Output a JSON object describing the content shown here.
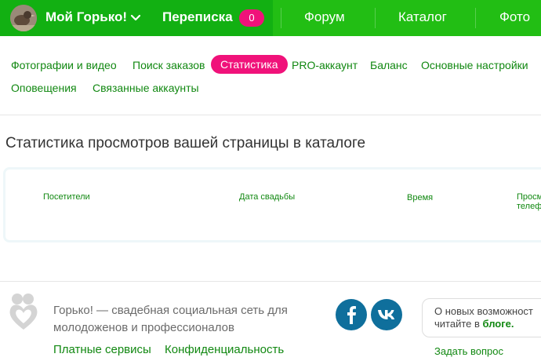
{
  "header": {
    "brand": "Мой Горько!",
    "messages_label": "Переписка",
    "messages_count": "0",
    "nav": [
      "Форум",
      "Каталог",
      "Фото"
    ]
  },
  "tabs": [
    "Фотографии и видео",
    "Поиск заказов",
    "Статистика",
    "PRO-аккаунт",
    "Баланс",
    "Основные настройки",
    "Оповещения",
    "Связанные аккаунты"
  ],
  "active_tab": "Статистика",
  "main": {
    "title": "Статистика просмотров вашей страницы в каталоге",
    "columns": [
      "Посетители",
      "Дата свадьбы",
      "Время",
      "Просмотр",
      "телефона"
    ]
  },
  "footer": {
    "description": "Горько! — свадебная социальная сеть для молодоженов и профессионалов",
    "links": [
      "Платные сервисы",
      "Конфиденциальность"
    ],
    "info_line1": "О новых возможност",
    "info_line2_prefix": "читайте в ",
    "info_line2_link": "блоге.",
    "ask": "Задать вопрос"
  },
  "colors": {
    "brand_green": "#22be14",
    "accent_pink": "#f0127a",
    "link_green": "#118811"
  }
}
